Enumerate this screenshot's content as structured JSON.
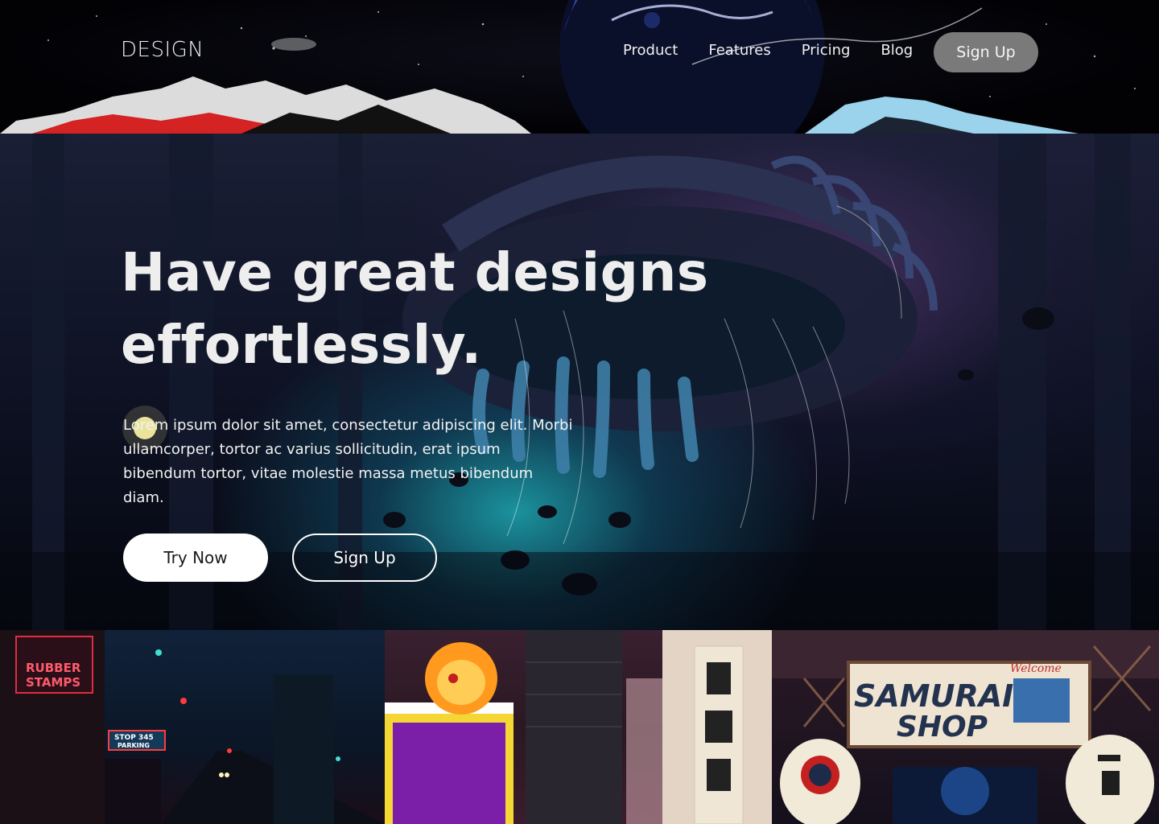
{
  "header": {
    "logo": "DESIGN",
    "nav": [
      "Product",
      "Features",
      "Pricing",
      "Blog"
    ],
    "signup_label": "Sign Up"
  },
  "hero": {
    "title": "Have great designs effortlessly.",
    "body": "Lorem ipsum dolor sit amet, consectetur adipiscing elit. Morbi ullamcorper, tortor ac varius sollicitudin, erat ipsum bibendum tortor, vitae molestie massa metus bibendum diam.",
    "try_label": "Try Now",
    "signup_label": "Sign Up"
  },
  "gallery": {
    "tile1": {
      "sign_top": "RUBBER",
      "sign_bottom": "STAMPS",
      "parking_top": "STOP 345",
      "parking_bottom": "PARKING"
    },
    "tile3": {
      "sign_line1": "SAMURAI",
      "sign_line2": "SHOP",
      "welcome": "Welcome"
    }
  },
  "colors": {
    "nav_signup_bg": "#7a7a7a",
    "try_bg": "#ffffff",
    "page_bg": "#05060c"
  }
}
